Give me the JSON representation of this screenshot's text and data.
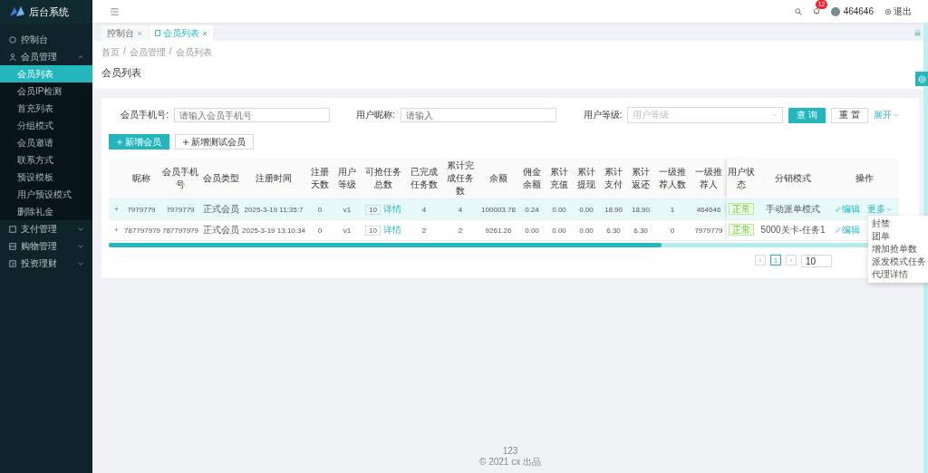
{
  "sidebar": {
    "logo_text": "后台系统",
    "items": [
      {
        "label": "控制台"
      },
      {
        "label": "会员管理",
        "expanded": true,
        "children": [
          {
            "label": "会员列表",
            "selected": true
          },
          {
            "label": "会员IP检测",
            "selected": false
          },
          {
            "label": "首充列表",
            "selected": false
          },
          {
            "label": "分组模式",
            "selected": false
          },
          {
            "label": "会员邀请",
            "selected": false
          },
          {
            "label": "联系方式",
            "selected": false
          },
          {
            "label": "预设模板",
            "selected": false
          },
          {
            "label": "用户预设模式",
            "selected": false
          },
          {
            "label": "删除礼金",
            "selected": false
          }
        ]
      },
      {
        "label": "支付管理",
        "expanded": false
      },
      {
        "label": "购物管理",
        "expanded": false
      },
      {
        "label": "投资理财",
        "expanded": false
      }
    ]
  },
  "header": {
    "notification_count": "12",
    "username": "464646",
    "logout": "退出"
  },
  "tabs": [
    {
      "label": "控制台",
      "selected": false
    },
    {
      "label": "会员列表",
      "selected": true
    }
  ],
  "breadcrumb": {
    "items": [
      "首页",
      "会员管理",
      "会员列表"
    ],
    "separator": "/"
  },
  "page_title": "会员列表",
  "filters": [
    {
      "label": "会员手机号:",
      "placeholder": "请输入会员手机号",
      "kind": "input"
    },
    {
      "label": "用户昵称:",
      "placeholder": "请输入",
      "kind": "input"
    },
    {
      "label": "用户等级:",
      "placeholder": "用户等级",
      "kind": "select"
    }
  ],
  "filter_buttons": {
    "search": "查 询",
    "reset": "重 置",
    "expand": "展开"
  },
  "actions": [
    {
      "label": "新增会员",
      "kind": "primary"
    },
    {
      "label": "新增测试会员",
      "kind": "default"
    }
  ],
  "table": {
    "columns": [
      "",
      "昵称",
      "会员手机号",
      "会员类型",
      "注册时间",
      "注册天数",
      "用户等级",
      "可抢任务总数",
      "已完成任务数",
      "累计完成任务数",
      "余额",
      "佣金余额",
      "累计充值",
      "累计提现",
      "累计支付",
      "累计返还",
      "一级推荐人数",
      "一级推荐人",
      "用户状态",
      "分销模式",
      "操作"
    ],
    "rows": [
      {
        "highlighted": true,
        "cells": [
          {
            "kind": "expand"
          },
          "7979779",
          "7979779",
          "正式会员",
          "2025-3-19 11:35:7",
          "0",
          "v1",
          {
            "kind": "count_link",
            "count": "10",
            "link": "详情"
          },
          "4",
          "4",
          "100003.78",
          "0.24",
          "0.00",
          "0.00",
          "18.90",
          "18.90",
          "1",
          "464646",
          {
            "kind": "tag",
            "text": "正常"
          },
          "手动派单模式",
          {
            "kind": "actions",
            "edit": "编辑",
            "more": "更多"
          }
        ]
      },
      {
        "highlighted": false,
        "cells": [
          {
            "kind": "expand"
          },
          "787797979",
          "787797979",
          "正式会员",
          "2025-3-19 13:10:34",
          "0",
          "v1",
          {
            "kind": "count_link",
            "count": "10",
            "link": "详情"
          },
          "2",
          "2",
          "9261.26",
          "0.00",
          "0.00",
          "0.00",
          "6.30",
          "6.30",
          "0",
          "7979779",
          {
            "kind": "tag",
            "text": "正常"
          },
          "5000关卡-任务1",
          {
            "kind": "actions",
            "edit": "编辑"
          }
        ]
      }
    ]
  },
  "more_menu": [
    "封禁",
    "团单",
    "增加抢单数",
    "派发模式任务",
    "代理详情"
  ],
  "pagination": {
    "prev": "‹",
    "next": "›",
    "pages": [
      {
        "label": "1",
        "selected": true
      }
    ],
    "page_size": "10"
  },
  "footer": {
    "line_1": "123",
    "line_2": "© 2021 cx 出品"
  }
}
